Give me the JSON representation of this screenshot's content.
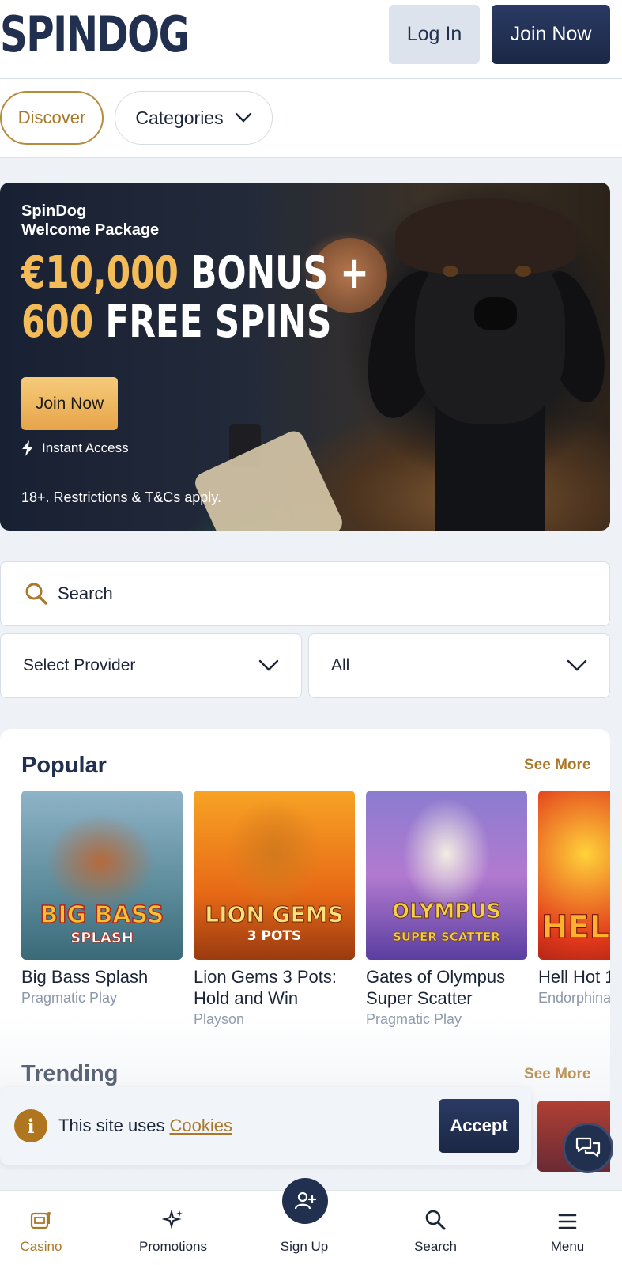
{
  "header": {
    "logo": "SPINDOG",
    "login_label": "Log In",
    "join_label": "Join Now"
  },
  "tabs": {
    "discover": "Discover",
    "categories": "Categories"
  },
  "banner": {
    "subtitle_line1": "SpinDog",
    "subtitle_line2": "Welcome Package",
    "bonus_amount": "€10,000",
    "bonus_word": " BONUS +",
    "spins_count": "600",
    "spins_word": " FREE SPINS",
    "join_label": "Join Now",
    "instant_access": "Instant Access",
    "terms": "18+. Restrictions & T&Cs apply."
  },
  "search": {
    "placeholder": "Search"
  },
  "filters": {
    "provider": "Select Provider",
    "type": "All"
  },
  "popular": {
    "title": "Popular",
    "see_more": "See More",
    "games": [
      {
        "name": "Big Bass Splash",
        "provider": "Pragmatic Play",
        "thumb_line1": "BIG BASS",
        "thumb_line2": "SPLASH"
      },
      {
        "name_line1": "Lion Gems 3 Pots:",
        "name_line2": "Hold and Win",
        "provider": "Playson",
        "thumb_line1": "LION GEMS",
        "thumb_line2": "3 POTS"
      },
      {
        "name_line1": "Gates of Olympus",
        "name_line2": "Super Scatter",
        "provider": "Pragmatic Play",
        "thumb_line1": "OLYMPUS",
        "thumb_line2": "SUPER SCATTER"
      },
      {
        "name": "Hell Hot 1",
        "provider": "Endorphina",
        "thumb_line1": "HEL"
      }
    ]
  },
  "trending": {
    "title": "Trending",
    "see_more": "See More"
  },
  "cookie": {
    "text": "This site uses",
    "link": "Cookies",
    "accept": "Accept"
  },
  "nav": {
    "casino": "Casino",
    "promotions": "Promotions",
    "signup": "Sign Up",
    "search": "Search",
    "menu": "Menu"
  },
  "colors": {
    "brand_navy": "#22304f",
    "accent_gold": "#a9782a",
    "banner_gold": "#f4bb59"
  }
}
